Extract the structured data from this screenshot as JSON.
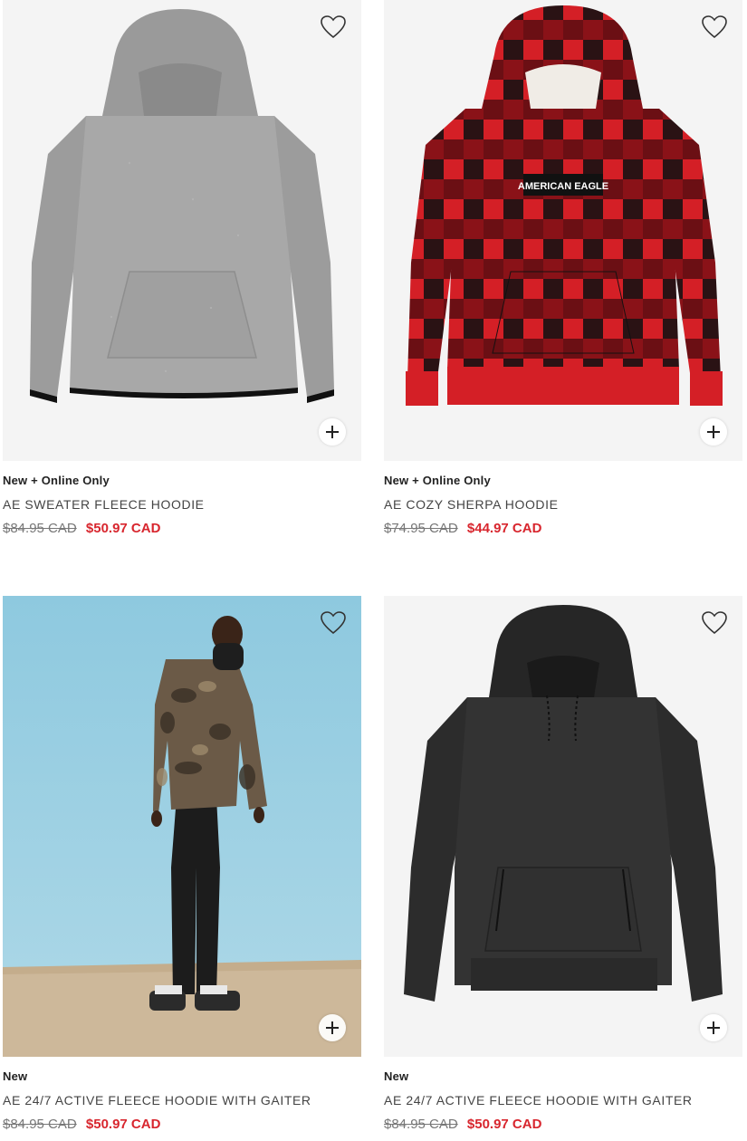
{
  "products": [
    {
      "badge": "New + Online Only",
      "name": "AE SWEATER FLEECE HOODIE",
      "was_price": "$84.95 CAD",
      "sale_price": "$50.97 CAD",
      "image_icon": "gray-hoodie-image"
    },
    {
      "badge": "New + Online Only",
      "name": "AE COZY SHERPA HOODIE",
      "was_price": "$74.95 CAD",
      "sale_price": "$44.97 CAD",
      "image_icon": "red-plaid-hoodie-image",
      "print_text": "AMERICAN EAGLE"
    },
    {
      "badge": "New",
      "name": "AE 24/7 ACTIVE FLEECE HOODIE WITH GAITER",
      "was_price": "$84.95 CAD",
      "sale_price": "$50.97 CAD",
      "image_icon": "camo-hoodie-model-image"
    },
    {
      "badge": "New",
      "name": "AE 24/7 ACTIVE FLEECE HOODIE WITH GAITER",
      "was_price": "$84.95 CAD",
      "sale_price": "$50.97 CAD",
      "image_icon": "black-hoodie-image"
    }
  ],
  "colors": {
    "sale": "#d8262e",
    "was": "#777777",
    "plaid_red": "#d41f26",
    "plaid_black": "#1a1214",
    "sky": "#8ec9df",
    "sand": "#cdb89a"
  },
  "icons": {
    "favorite": "heart-outline-icon",
    "quick_add": "plus-icon"
  }
}
